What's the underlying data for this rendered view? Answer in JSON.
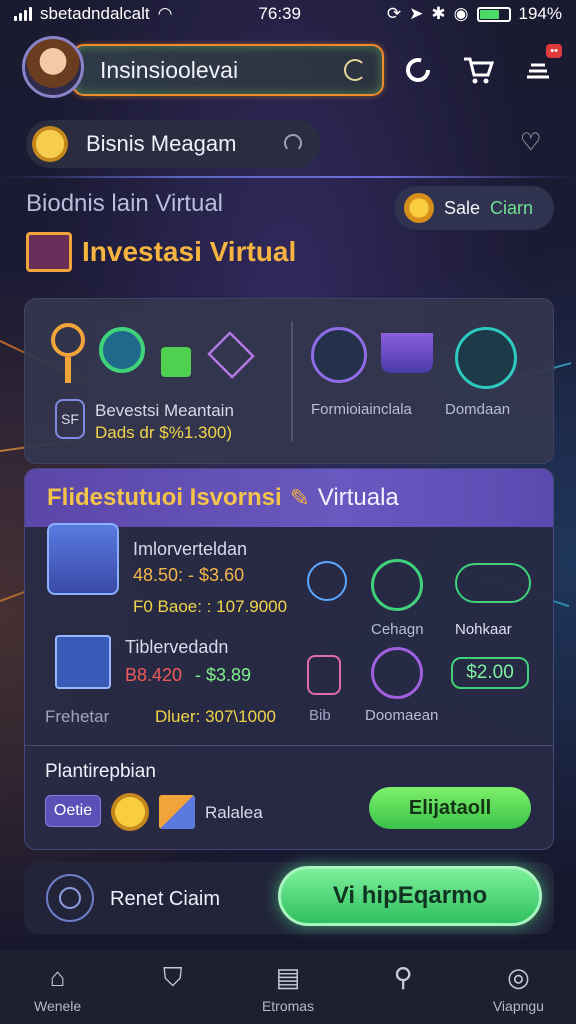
{
  "status": {
    "carrier": "sbetadndalcalt",
    "time": "76:39",
    "battery": "194%"
  },
  "header": {
    "search_text": "Insinsioolevai",
    "cart_badge": ""
  },
  "business_bar": {
    "label": "Bisnis Meagam"
  },
  "subtitle": "Biodnis lain Virtual",
  "section_title": "Investasi Virtual",
  "sale_button": {
    "part1": "Sale",
    "part2": "Ciarn"
  },
  "card1": {
    "left_line1": "Bevestsi Meantain",
    "left_line2_prefix": "Dads dr",
    "left_line2_value": "$%1.300)",
    "left_badge": "SF",
    "right_label1": "Formioiainclala",
    "right_label2": "Domdaan"
  },
  "card2": {
    "title_part1": "Flidestutuoi Isvornsi",
    "title_part2": "Virtuala",
    "row1": {
      "title": "Imlorverteldan",
      "range": "48.50: - $3.60",
      "detail": "F0 Baoe: : 107.9000"
    },
    "row2": {
      "title": "Tiblervedadn",
      "range_red": "B8.420",
      "range_green": "- $3.89",
      "detail": "Dluer: 307\\1000",
      "left_label": "Frehetar"
    },
    "labels": {
      "mid1": "Cehagn",
      "mid2": "Nohkaar",
      "price_pill": "$2.00",
      "bottom_mid1": "Bib",
      "bottom_mid2": "Doomaean"
    },
    "footer": {
      "title": "Plantirepbian",
      "chip": "Oetie",
      "label": "Ralalea",
      "button": "Elijataoll"
    }
  },
  "bottom": {
    "label": "Renet Ciaim",
    "button": "Vi hipEqarmo"
  },
  "nav": [
    {
      "icon": "home-icon",
      "label": "Wenele"
    },
    {
      "icon": "shield-icon",
      "label": ""
    },
    {
      "icon": "document-icon",
      "label": "Etromas"
    },
    {
      "icon": "search-icon",
      "label": ""
    },
    {
      "icon": "user-icon",
      "label": "Viapngu"
    }
  ]
}
